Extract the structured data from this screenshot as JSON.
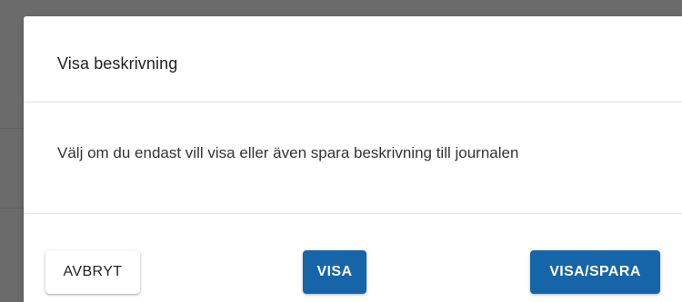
{
  "dialog": {
    "title": "Visa beskrivning",
    "message": "Välj om du endast vill visa eller även spara beskrivning till journalen",
    "buttons": {
      "cancel_label": "AVBRYT",
      "show_label": "VISA",
      "show_save_label": "VISA/SPARA"
    }
  },
  "colors": {
    "primary": "#1565a8",
    "backdrop": "#6b6b6b",
    "surface": "#ffffff"
  }
}
